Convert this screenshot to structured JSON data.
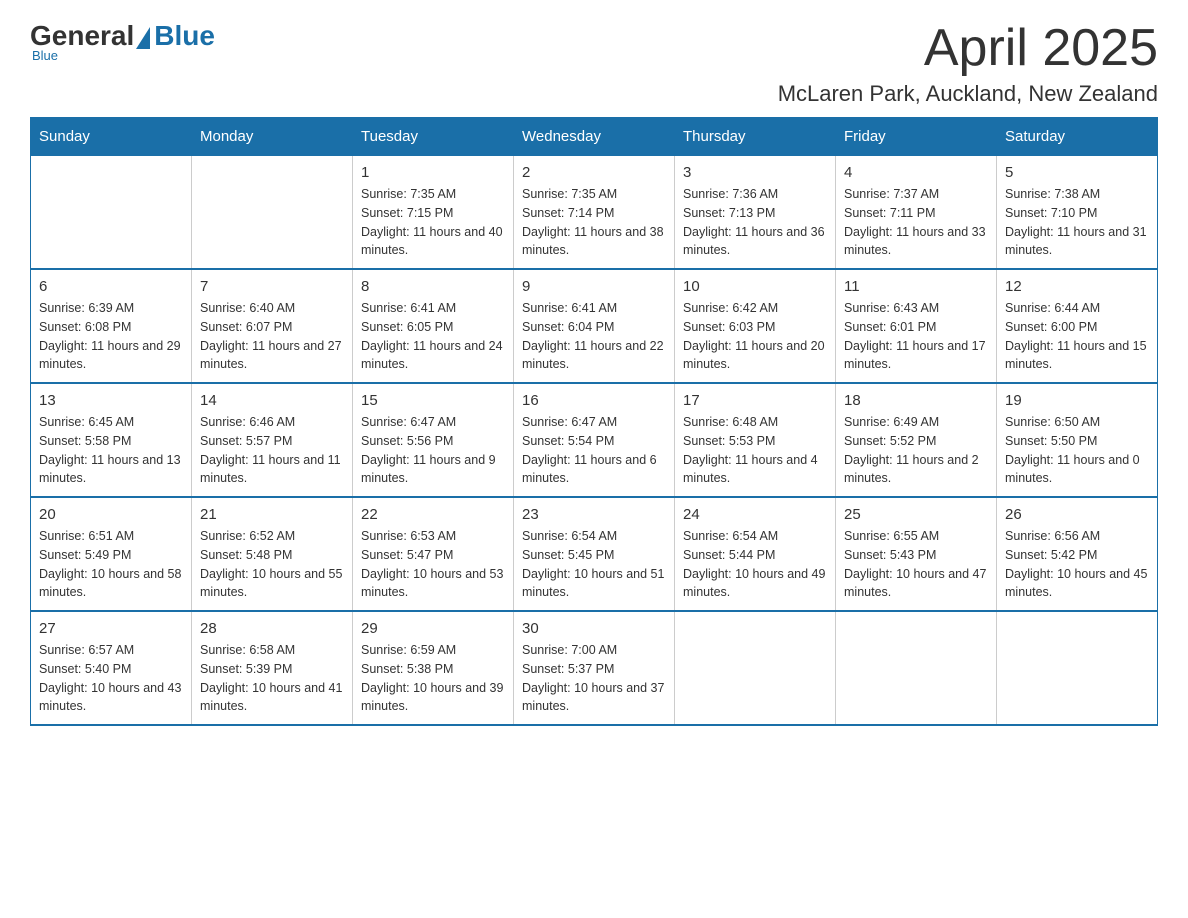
{
  "logo": {
    "general": "General",
    "blue": "Blue",
    "underline": "Blue"
  },
  "title": "April 2025",
  "subtitle": "McLaren Park, Auckland, New Zealand",
  "days_of_week": [
    "Sunday",
    "Monday",
    "Tuesday",
    "Wednesday",
    "Thursday",
    "Friday",
    "Saturday"
  ],
  "weeks": [
    [
      {
        "day": "",
        "sunrise": "",
        "sunset": "",
        "daylight": ""
      },
      {
        "day": "",
        "sunrise": "",
        "sunset": "",
        "daylight": ""
      },
      {
        "day": "1",
        "sunrise": "Sunrise: 7:35 AM",
        "sunset": "Sunset: 7:15 PM",
        "daylight": "Daylight: 11 hours and 40 minutes."
      },
      {
        "day": "2",
        "sunrise": "Sunrise: 7:35 AM",
        "sunset": "Sunset: 7:14 PM",
        "daylight": "Daylight: 11 hours and 38 minutes."
      },
      {
        "day": "3",
        "sunrise": "Sunrise: 7:36 AM",
        "sunset": "Sunset: 7:13 PM",
        "daylight": "Daylight: 11 hours and 36 minutes."
      },
      {
        "day": "4",
        "sunrise": "Sunrise: 7:37 AM",
        "sunset": "Sunset: 7:11 PM",
        "daylight": "Daylight: 11 hours and 33 minutes."
      },
      {
        "day": "5",
        "sunrise": "Sunrise: 7:38 AM",
        "sunset": "Sunset: 7:10 PM",
        "daylight": "Daylight: 11 hours and 31 minutes."
      }
    ],
    [
      {
        "day": "6",
        "sunrise": "Sunrise: 6:39 AM",
        "sunset": "Sunset: 6:08 PM",
        "daylight": "Daylight: 11 hours and 29 minutes."
      },
      {
        "day": "7",
        "sunrise": "Sunrise: 6:40 AM",
        "sunset": "Sunset: 6:07 PM",
        "daylight": "Daylight: 11 hours and 27 minutes."
      },
      {
        "day": "8",
        "sunrise": "Sunrise: 6:41 AM",
        "sunset": "Sunset: 6:05 PM",
        "daylight": "Daylight: 11 hours and 24 minutes."
      },
      {
        "day": "9",
        "sunrise": "Sunrise: 6:41 AM",
        "sunset": "Sunset: 6:04 PM",
        "daylight": "Daylight: 11 hours and 22 minutes."
      },
      {
        "day": "10",
        "sunrise": "Sunrise: 6:42 AM",
        "sunset": "Sunset: 6:03 PM",
        "daylight": "Daylight: 11 hours and 20 minutes."
      },
      {
        "day": "11",
        "sunrise": "Sunrise: 6:43 AM",
        "sunset": "Sunset: 6:01 PM",
        "daylight": "Daylight: 11 hours and 17 minutes."
      },
      {
        "day": "12",
        "sunrise": "Sunrise: 6:44 AM",
        "sunset": "Sunset: 6:00 PM",
        "daylight": "Daylight: 11 hours and 15 minutes."
      }
    ],
    [
      {
        "day": "13",
        "sunrise": "Sunrise: 6:45 AM",
        "sunset": "Sunset: 5:58 PM",
        "daylight": "Daylight: 11 hours and 13 minutes."
      },
      {
        "day": "14",
        "sunrise": "Sunrise: 6:46 AM",
        "sunset": "Sunset: 5:57 PM",
        "daylight": "Daylight: 11 hours and 11 minutes."
      },
      {
        "day": "15",
        "sunrise": "Sunrise: 6:47 AM",
        "sunset": "Sunset: 5:56 PM",
        "daylight": "Daylight: 11 hours and 9 minutes."
      },
      {
        "day": "16",
        "sunrise": "Sunrise: 6:47 AM",
        "sunset": "Sunset: 5:54 PM",
        "daylight": "Daylight: 11 hours and 6 minutes."
      },
      {
        "day": "17",
        "sunrise": "Sunrise: 6:48 AM",
        "sunset": "Sunset: 5:53 PM",
        "daylight": "Daylight: 11 hours and 4 minutes."
      },
      {
        "day": "18",
        "sunrise": "Sunrise: 6:49 AM",
        "sunset": "Sunset: 5:52 PM",
        "daylight": "Daylight: 11 hours and 2 minutes."
      },
      {
        "day": "19",
        "sunrise": "Sunrise: 6:50 AM",
        "sunset": "Sunset: 5:50 PM",
        "daylight": "Daylight: 11 hours and 0 minutes."
      }
    ],
    [
      {
        "day": "20",
        "sunrise": "Sunrise: 6:51 AM",
        "sunset": "Sunset: 5:49 PM",
        "daylight": "Daylight: 10 hours and 58 minutes."
      },
      {
        "day": "21",
        "sunrise": "Sunrise: 6:52 AM",
        "sunset": "Sunset: 5:48 PM",
        "daylight": "Daylight: 10 hours and 55 minutes."
      },
      {
        "day": "22",
        "sunrise": "Sunrise: 6:53 AM",
        "sunset": "Sunset: 5:47 PM",
        "daylight": "Daylight: 10 hours and 53 minutes."
      },
      {
        "day": "23",
        "sunrise": "Sunrise: 6:54 AM",
        "sunset": "Sunset: 5:45 PM",
        "daylight": "Daylight: 10 hours and 51 minutes."
      },
      {
        "day": "24",
        "sunrise": "Sunrise: 6:54 AM",
        "sunset": "Sunset: 5:44 PM",
        "daylight": "Daylight: 10 hours and 49 minutes."
      },
      {
        "day": "25",
        "sunrise": "Sunrise: 6:55 AM",
        "sunset": "Sunset: 5:43 PM",
        "daylight": "Daylight: 10 hours and 47 minutes."
      },
      {
        "day": "26",
        "sunrise": "Sunrise: 6:56 AM",
        "sunset": "Sunset: 5:42 PM",
        "daylight": "Daylight: 10 hours and 45 minutes."
      }
    ],
    [
      {
        "day": "27",
        "sunrise": "Sunrise: 6:57 AM",
        "sunset": "Sunset: 5:40 PM",
        "daylight": "Daylight: 10 hours and 43 minutes."
      },
      {
        "day": "28",
        "sunrise": "Sunrise: 6:58 AM",
        "sunset": "Sunset: 5:39 PM",
        "daylight": "Daylight: 10 hours and 41 minutes."
      },
      {
        "day": "29",
        "sunrise": "Sunrise: 6:59 AM",
        "sunset": "Sunset: 5:38 PM",
        "daylight": "Daylight: 10 hours and 39 minutes."
      },
      {
        "day": "30",
        "sunrise": "Sunrise: 7:00 AM",
        "sunset": "Sunset: 5:37 PM",
        "daylight": "Daylight: 10 hours and 37 minutes."
      },
      {
        "day": "",
        "sunrise": "",
        "sunset": "",
        "daylight": ""
      },
      {
        "day": "",
        "sunrise": "",
        "sunset": "",
        "daylight": ""
      },
      {
        "day": "",
        "sunrise": "",
        "sunset": "",
        "daylight": ""
      }
    ]
  ]
}
